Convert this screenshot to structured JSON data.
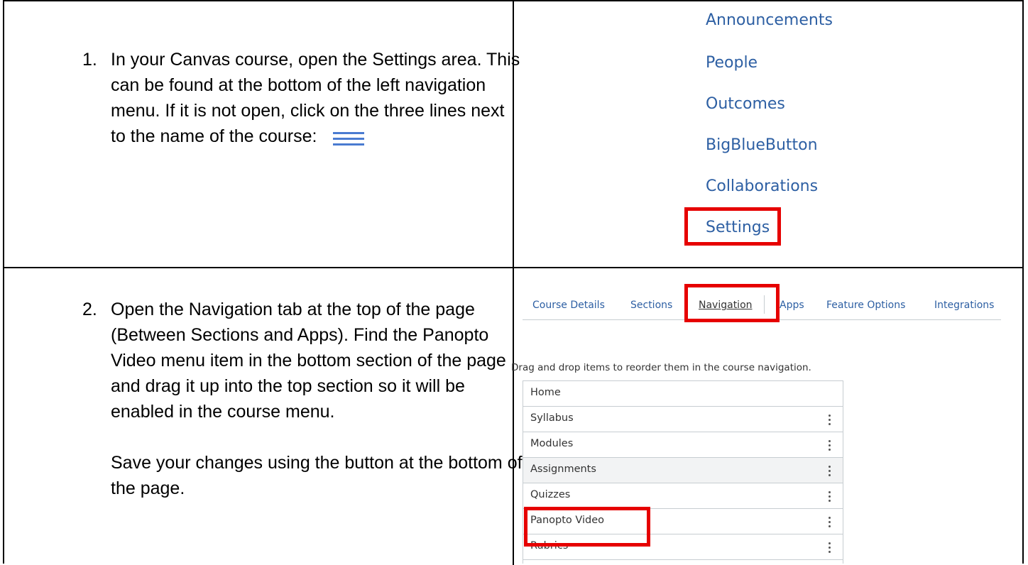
{
  "step1": {
    "number": "1.",
    "text": "In your Canvas course, open the Settings area. This can be found at the bottom of the left navigation menu. If it is not open, click on the three lines next to the name of the course:"
  },
  "step2": {
    "number": "2.",
    "text": "Open the Navigation tab at the top of the page (Between Sections and Apps). Find the Panopto Video menu item in the bottom section of the page and drag it up into the top section so it will be enabled in the course menu.",
    "text2": "Save your changes using the button at the bottom of the page."
  },
  "course_nav": {
    "items": [
      "Announcements",
      "People",
      "Outcomes",
      "BigBlueButton",
      "Collaborations",
      "Settings"
    ]
  },
  "settings_tabs": [
    "Course Details",
    "Sections",
    "Navigation",
    "Apps",
    "Feature Options",
    "Integrations"
  ],
  "instructions": "Drag and drop items to reorder them in the course navigation.",
  "nav_list": [
    "Home",
    "Syllabus",
    "Modules",
    "Assignments",
    "Quizzes",
    "Panopto Video",
    "Rubrics"
  ],
  "colors": {
    "link": "#2d5fa3",
    "highlight": "#e60000"
  }
}
